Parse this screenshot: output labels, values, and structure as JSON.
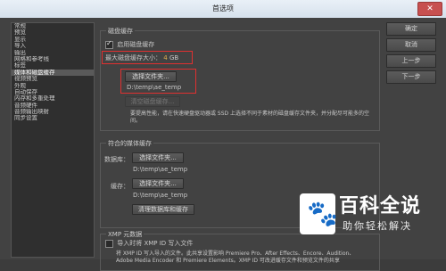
{
  "window": {
    "title": "首选项",
    "close_glyph": "✕"
  },
  "sidebar": {
    "items": [
      "常规",
      "预览",
      "显示",
      "导入",
      "输出",
      "网格和参考线",
      "标签",
      "媒体和磁盘缓存",
      "视频预览",
      "外观",
      "自动保存",
      "内存和多重处理",
      "音频硬件",
      "音频输出映射",
      "同步设置"
    ],
    "selected_index": 7
  },
  "disk_cache": {
    "group_title": "磁盘缓存",
    "enable_label": "启用磁盘缓存",
    "enable_checked": true,
    "max_size_label": "最大磁盘缓存大小：",
    "max_size_value": "4",
    "max_size_unit": "GB",
    "select_folder_button": "选择文件夹...",
    "path": "D:\\temp\\ae_temp",
    "clear_button": "清空磁盘缓存...",
    "note": "要提高性能，请在快速硬盘驱动器或 SSD 上选择不同于素材的磁盘缓存文件夹，并分配尽可能多的空间。"
  },
  "media_cache": {
    "group_title": "符合的媒体缓存",
    "database_label": "数据库：",
    "database_button": "选择文件夹...",
    "database_path": "D:\\temp\\ae_temp",
    "cache_label": "缓存：",
    "cache_button": "选择文件夹...",
    "cache_path": "D:\\temp\\ae_temp",
    "clean_button": "清理数据库和缓存"
  },
  "xmp": {
    "group_title": "XMP 元数据",
    "write_label": "导入时将 XMP ID 写入文件",
    "write_checked": false,
    "desc_line1": "将 XMP ID 写入导入的文件。此共享设置影响 Premiere Pro、After Effects、Encore、Audition、",
    "desc_line2": "Adobe Media Encoder 和 Premiere Elements。XMP ID 可改进缓存文件和预览文件的共享"
  },
  "buttons": {
    "ok": "确定",
    "cancel": "取消",
    "prev": "上一步",
    "next": "下一步"
  },
  "watermark": {
    "title": "百科全说",
    "subtitle": "助你轻松解决",
    "logo_icon": "paw-icon"
  },
  "colors": {
    "highlight": "#e03030",
    "background": "#424242"
  }
}
